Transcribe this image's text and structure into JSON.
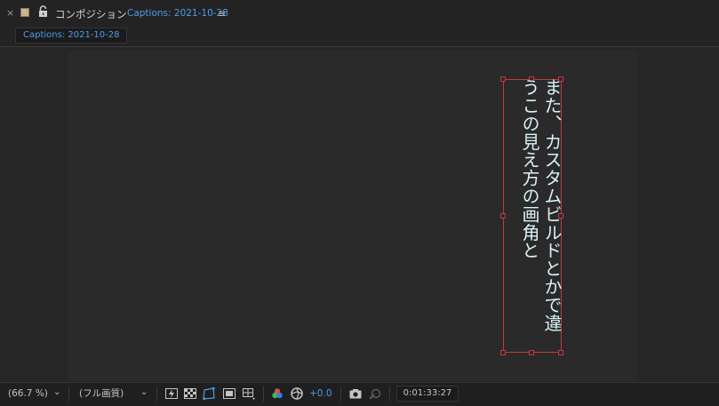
{
  "panel": {
    "close_glyph": "×",
    "title": "コンポジション",
    "composition_name": "Captions: 2021-10-28",
    "menu_glyph": "≡",
    "swatch_color": "#c9b48f"
  },
  "tab": {
    "label": "Captions: 2021-10-28"
  },
  "caption": {
    "line1": "また、カスタムビルドとかで違",
    "line2": "うこの見え方の画角と",
    "text_color": "#d8f2f6",
    "box_color": "#c8393b"
  },
  "toolbar": {
    "zoom": "(66.7 %)",
    "resolution": "(フル画質)",
    "exposure": "+0.0",
    "timecode": "0:01:33:27",
    "chevron_glyph": "⌄"
  },
  "icons": [
    "close-icon",
    "color-swatch-icon",
    "lock-icon",
    "panel-menu-icon",
    "fast-preview-icon",
    "transparency-grid-icon",
    "mask-path-icon",
    "region-of-interest-icon",
    "grid-guides-icon",
    "channel-icon",
    "color-management-icon",
    "snapshot-icon",
    "show-snapshot-icon"
  ],
  "accent_color": "#4d9ce6"
}
